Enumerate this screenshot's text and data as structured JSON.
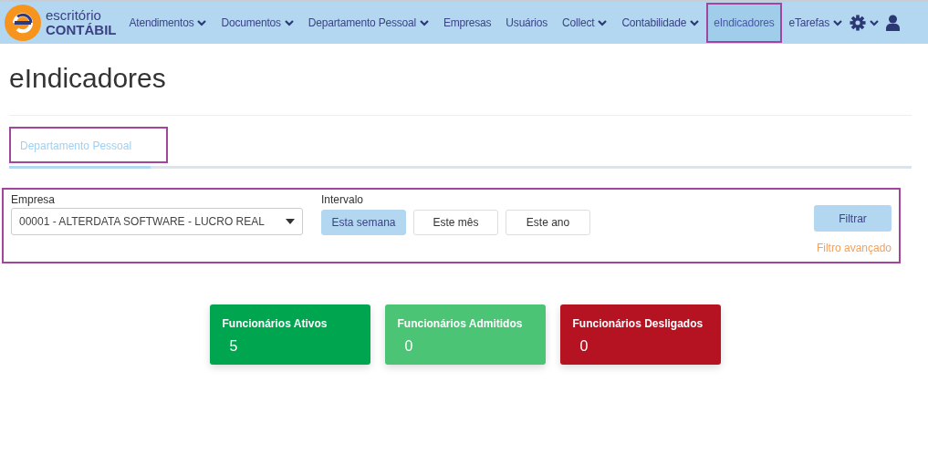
{
  "brand": {
    "line1": "escritório",
    "line2": "CONTÁBIL"
  },
  "nav": [
    {
      "label": "Atendimentos",
      "dropdown": true,
      "selected": false
    },
    {
      "label": "Documentos",
      "dropdown": true,
      "selected": false
    },
    {
      "label": "Departamento Pessoal",
      "dropdown": true,
      "selected": false
    },
    {
      "label": "Empresas",
      "dropdown": false,
      "selected": false
    },
    {
      "label": "Usuários",
      "dropdown": false,
      "selected": false
    },
    {
      "label": "Collect",
      "dropdown": true,
      "selected": false
    },
    {
      "label": "Contabilidade",
      "dropdown": true,
      "selected": false
    },
    {
      "label": "eIndicadores",
      "dropdown": false,
      "selected": true
    },
    {
      "label": "eTarefas",
      "dropdown": true,
      "selected": false
    }
  ],
  "page_title": "eIndicadores",
  "tabs": [
    {
      "label": "Departamento Pessoal",
      "selected": true
    }
  ],
  "filters": {
    "empresa_label": "Empresa",
    "empresa_value": "00001 - ALTERDATA SOFTWARE - LUCRO REAL",
    "intervalo_label": "Intervalo",
    "intervals": [
      {
        "label": "Esta semana",
        "selected": true
      },
      {
        "label": "Este mês",
        "selected": false
      },
      {
        "label": "Este ano",
        "selected": false
      }
    ],
    "filter_button": "Filtrar",
    "advanced_link": "Filtro avançado"
  },
  "cards": [
    {
      "title": "Funcionários Ativos",
      "value": "5",
      "color": "#00a64f"
    },
    {
      "title": "Funcionários Admitidos",
      "value": "0",
      "color": "#4bc475"
    },
    {
      "title": "Funcionários Desligados",
      "value": "0",
      "color": "#b51222"
    }
  ]
}
